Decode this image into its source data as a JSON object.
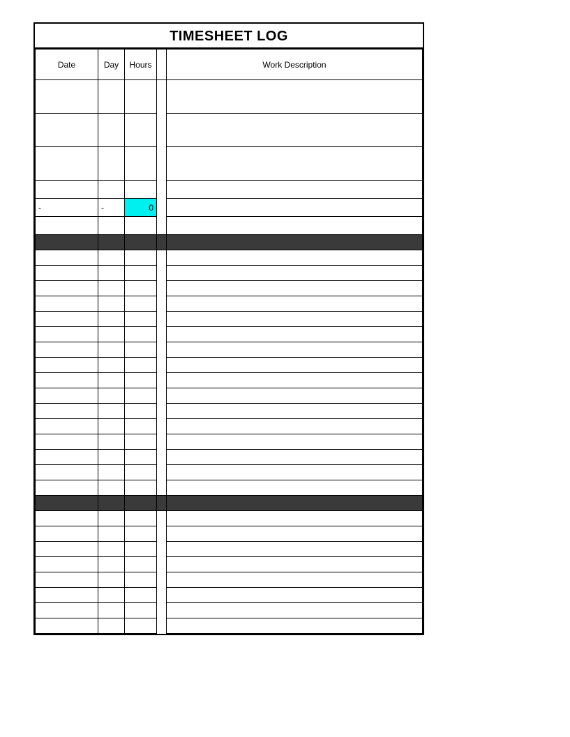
{
  "title": "TIMESHEET LOG",
  "headers": {
    "date": "Date",
    "day": "Day",
    "hours": "Hours",
    "description": "Work Description"
  },
  "section1": {
    "rows": [
      {
        "date": "",
        "day": "",
        "hours": "",
        "description": ""
      },
      {
        "date": "",
        "day": "",
        "hours": "",
        "description": ""
      },
      {
        "date": "",
        "day": "",
        "hours": "",
        "description": ""
      },
      {
        "date": "",
        "day": "",
        "hours": "",
        "description": ""
      }
    ],
    "total": {
      "date": "-",
      "day": "-",
      "hours": "0",
      "description": ""
    }
  },
  "section2": {
    "rows": [
      {
        "date": "",
        "day": "",
        "hours": "",
        "description": ""
      },
      {
        "date": "",
        "day": "",
        "hours": "",
        "description": ""
      },
      {
        "date": "",
        "day": "",
        "hours": "",
        "description": ""
      },
      {
        "date": "",
        "day": "",
        "hours": "",
        "description": ""
      },
      {
        "date": "",
        "day": "",
        "hours": "",
        "description": ""
      },
      {
        "date": "",
        "day": "",
        "hours": "",
        "description": ""
      },
      {
        "date": "",
        "day": "",
        "hours": "",
        "description": ""
      },
      {
        "date": "",
        "day": "",
        "hours": "",
        "description": ""
      },
      {
        "date": "",
        "day": "",
        "hours": "",
        "description": ""
      },
      {
        "date": "",
        "day": "",
        "hours": "",
        "description": ""
      },
      {
        "date": "",
        "day": "",
        "hours": "",
        "description": ""
      },
      {
        "date": "",
        "day": "",
        "hours": "",
        "description": ""
      },
      {
        "date": "",
        "day": "",
        "hours": "",
        "description": ""
      },
      {
        "date": "",
        "day": "",
        "hours": "",
        "description": ""
      },
      {
        "date": "",
        "day": "",
        "hours": "",
        "description": ""
      },
      {
        "date": "",
        "day": "",
        "hours": "",
        "description": ""
      }
    ]
  },
  "section3": {
    "rows": [
      {
        "date": "",
        "day": "",
        "hours": "",
        "description": ""
      },
      {
        "date": "",
        "day": "",
        "hours": "",
        "description": ""
      },
      {
        "date": "",
        "day": "",
        "hours": "",
        "description": ""
      },
      {
        "date": "",
        "day": "",
        "hours": "",
        "description": ""
      },
      {
        "date": "",
        "day": "",
        "hours": "",
        "description": ""
      },
      {
        "date": "",
        "day": "",
        "hours": "",
        "description": ""
      },
      {
        "date": "",
        "day": "",
        "hours": "",
        "description": ""
      },
      {
        "date": "",
        "day": "",
        "hours": "",
        "description": ""
      }
    ]
  }
}
